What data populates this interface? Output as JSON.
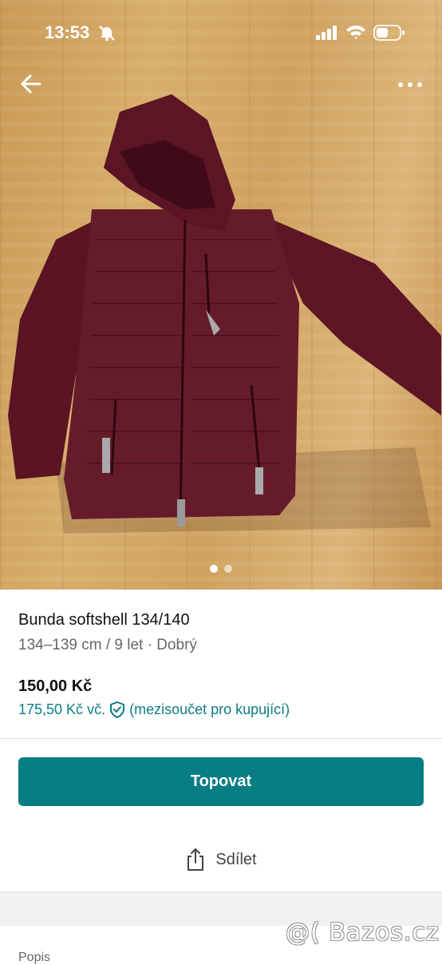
{
  "status_bar": {
    "time": "13:53"
  },
  "photo": {
    "description_icon": "jacket-photo",
    "page_count": 2,
    "current_page": 1
  },
  "listing": {
    "title": "Bunda softshell 134/140",
    "subtitle": "134–139 cm / 9 let · Dobrý",
    "price": "150,00 Kč",
    "buyer_price": "175,50 Kč vč.",
    "buyer_note": "(mezisoučet pro kupující)"
  },
  "actions": {
    "promote_label": "Topovat",
    "share_label": "Sdílet"
  },
  "section": {
    "description_label": "Popis"
  },
  "watermark": "@( Bazos.cz",
  "colors": {
    "accent": "#087d83",
    "link": "#0e7c86",
    "jacket": "#6b1b2c"
  }
}
